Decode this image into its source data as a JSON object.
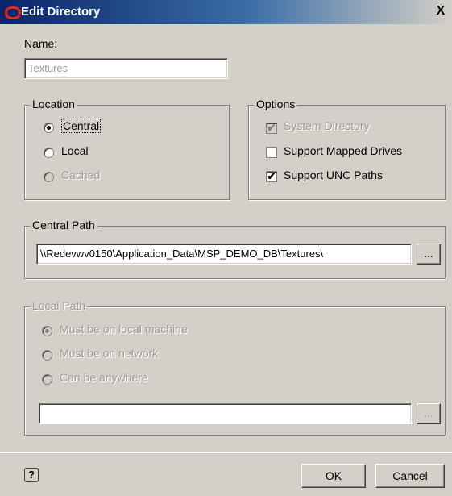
{
  "window": {
    "title": "Edit Directory",
    "close_glyph": "X"
  },
  "name": {
    "label": "Name:",
    "value": "Textures"
  },
  "location": {
    "legend": "Location",
    "options": [
      {
        "label": "Central",
        "selected": true,
        "enabled": true
      },
      {
        "label": "Local",
        "selected": false,
        "enabled": true
      },
      {
        "label": "Cached",
        "selected": false,
        "enabled": false
      }
    ]
  },
  "options": {
    "legend": "Options",
    "items": [
      {
        "label": "System Directory",
        "checked": true,
        "enabled": false
      },
      {
        "label": "Support Mapped Drives",
        "checked": false,
        "enabled": true
      },
      {
        "label": "Support UNC Paths",
        "checked": true,
        "enabled": true
      }
    ]
  },
  "central_path": {
    "legend": "Central Path",
    "value": "\\\\Redevwv0150\\Application_Data\\MSP_DEMO_DB\\Textures\\",
    "browse_label": "..."
  },
  "local_path": {
    "legend": "Local Path",
    "options": [
      {
        "label": "Must be on local machine",
        "selected": true
      },
      {
        "label": "Must be on network",
        "selected": false
      },
      {
        "label": "Can be anywhere",
        "selected": false
      }
    ],
    "value": "",
    "browse_label": "..."
  },
  "footer": {
    "help_glyph": "?",
    "ok_label": "OK",
    "cancel_label": "Cancel"
  },
  "colors": {
    "dialog_bg": "#d4d0c8",
    "title_start": "#0a246a",
    "title_end": "#d4d0c8",
    "logo_red": "#e8231b"
  }
}
